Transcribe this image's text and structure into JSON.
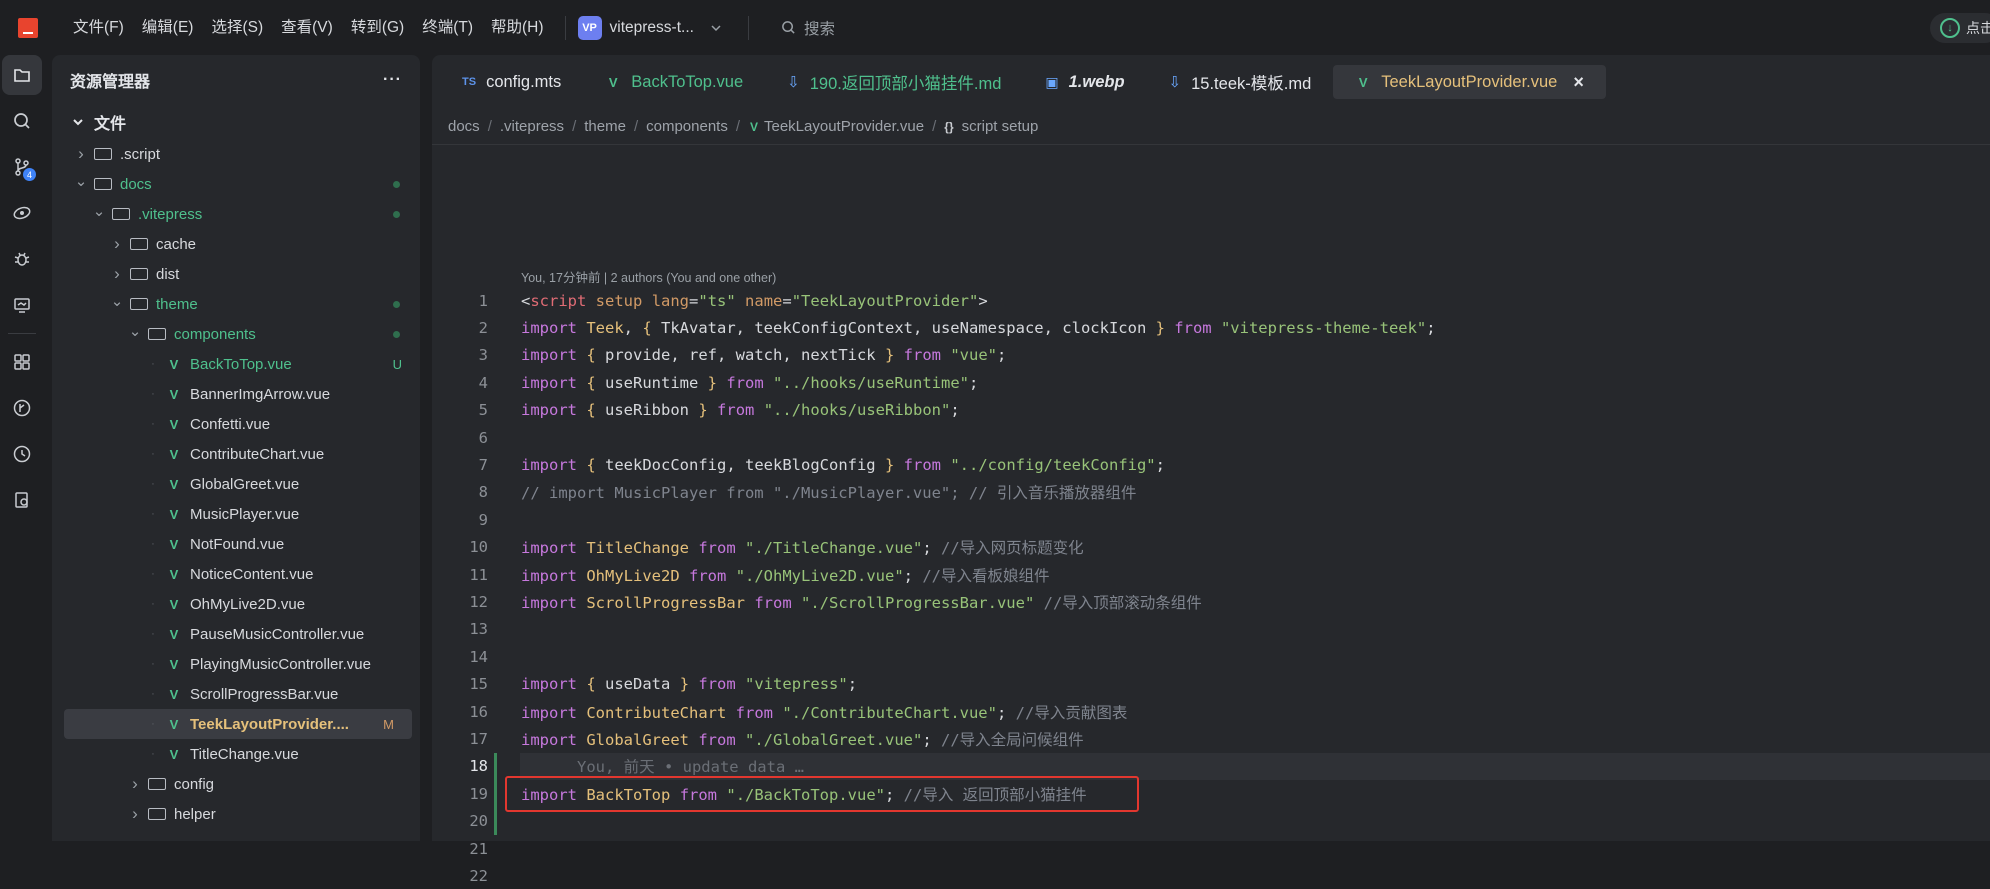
{
  "menu": [
    "文件(F)",
    "编辑(E)",
    "选择(S)",
    "查看(V)",
    "转到(G)",
    "终端(T)",
    "帮助(H)"
  ],
  "project": {
    "badge": "VP",
    "name": "vitepress-t..."
  },
  "search_label": "搜索",
  "right_control_label": "点击",
  "activity_badge": "4",
  "sidebar": {
    "title": "资源管理器",
    "more": "···",
    "section": "文件"
  },
  "tree": [
    {
      "label": ".script",
      "type": "folder",
      "depth": 0,
      "open": false,
      "color": "normal"
    },
    {
      "label": "docs",
      "type": "folder",
      "depth": 0,
      "open": true,
      "color": "green",
      "dot": true
    },
    {
      "label": ".vitepress",
      "type": "folder",
      "depth": 1,
      "open": true,
      "color": "green",
      "dot": true
    },
    {
      "label": "cache",
      "type": "folder",
      "depth": 2,
      "open": false,
      "color": "normal"
    },
    {
      "label": "dist",
      "type": "folder",
      "depth": 2,
      "open": false,
      "color": "normal"
    },
    {
      "label": "theme",
      "type": "folder",
      "depth": 2,
      "open": true,
      "color": "green",
      "dot": true
    },
    {
      "label": "components",
      "type": "folder",
      "depth": 3,
      "open": true,
      "color": "green",
      "dot": true
    },
    {
      "label": "BackToTop.vue",
      "type": "vue",
      "depth": 4,
      "color": "green",
      "status": "U"
    },
    {
      "label": "BannerImgArrow.vue",
      "type": "vue",
      "depth": 4,
      "color": "normal"
    },
    {
      "label": "Confetti.vue",
      "type": "vue",
      "depth": 4,
      "color": "normal"
    },
    {
      "label": "ContributeChart.vue",
      "type": "vue",
      "depth": 4,
      "color": "normal"
    },
    {
      "label": "GlobalGreet.vue",
      "type": "vue",
      "depth": 4,
      "color": "normal"
    },
    {
      "label": "MusicPlayer.vue",
      "type": "vue",
      "depth": 4,
      "color": "normal"
    },
    {
      "label": "NotFound.vue",
      "type": "vue",
      "depth": 4,
      "color": "normal"
    },
    {
      "label": "NoticeContent.vue",
      "type": "vue",
      "depth": 4,
      "color": "normal"
    },
    {
      "label": "OhMyLive2D.vue",
      "type": "vue",
      "depth": 4,
      "color": "normal"
    },
    {
      "label": "PauseMusicController.vue",
      "type": "vue",
      "depth": 4,
      "color": "normal"
    },
    {
      "label": "PlayingMusicController.vue",
      "type": "vue",
      "depth": 4,
      "color": "normal"
    },
    {
      "label": "ScrollProgressBar.vue",
      "type": "vue",
      "depth": 4,
      "color": "normal"
    },
    {
      "label": "TeekLayoutProvider....",
      "type": "vue",
      "depth": 4,
      "color": "mod",
      "status": "M",
      "selected": true
    },
    {
      "label": "TitleChange.vue",
      "type": "vue",
      "depth": 4,
      "color": "normal"
    },
    {
      "label": "config",
      "type": "folder",
      "depth": 3,
      "open": false,
      "color": "normal"
    },
    {
      "label": "helper",
      "type": "folder",
      "depth": 3,
      "open": false,
      "color": "normal"
    }
  ],
  "tabs": [
    {
      "label": "config.mts",
      "icon": "TS",
      "color": "#e4e6ea",
      "italic": false
    },
    {
      "label": "BackToTop.vue",
      "icon": "vue",
      "color": "#4fc08d",
      "italic": false
    },
    {
      "label": "190.返回顶部小猫挂件.md",
      "icon": "md",
      "color": "#4fc08d",
      "italic": false
    },
    {
      "label": "1.webp",
      "icon": "img",
      "color": "#e4e6ea",
      "italic": true
    },
    {
      "label": "15.teek-模板.md",
      "icon": "md",
      "color": "#e4e6ea",
      "italic": false
    },
    {
      "label": "TeekLayoutProvider.vue",
      "icon": "vue",
      "color": "#e5c07b",
      "italic": false,
      "active": true,
      "close": "×"
    }
  ],
  "breadcrumb": [
    "docs",
    ".vitepress",
    "theme",
    "components",
    "TeekLayoutProvider.vue",
    "script setup"
  ],
  "breadcrumb_braces": "{}",
  "codelens": "You, 17分钟前 | 2 authors (You and one other)",
  "current_line": 18,
  "ghost_blame": "You, 前天 • update data …",
  "code": [
    [
      [
        "p",
        "<"
      ],
      [
        "tg",
        "script"
      ],
      [
        "at",
        " setup"
      ],
      [
        "p",
        " "
      ],
      [
        "at",
        "lang"
      ],
      [
        "p",
        "="
      ],
      [
        "st",
        "\"ts\""
      ],
      [
        "p",
        " "
      ],
      [
        "at",
        "name"
      ],
      [
        "p",
        "="
      ],
      [
        "st",
        "\"TeekLayoutProvider\""
      ],
      [
        "p",
        ">"
      ]
    ],
    [
      [
        "k",
        "import"
      ],
      [
        "p",
        " "
      ],
      [
        "f",
        "Teek"
      ],
      [
        "p",
        ", "
      ],
      [
        "f",
        "{"
      ],
      [
        "p",
        " TkAvatar, teekConfigContext, useNamespace, clockIcon "
      ],
      [
        "f",
        "}"
      ],
      [
        "p",
        " "
      ],
      [
        "k",
        "from"
      ],
      [
        "p",
        " "
      ],
      [
        "st",
        "\"vitepress-theme-teek\""
      ],
      [
        "p",
        ";"
      ]
    ],
    [
      [
        "k",
        "import"
      ],
      [
        "p",
        " "
      ],
      [
        "f",
        "{"
      ],
      [
        "p",
        " provide, ref, watch, nextTick "
      ],
      [
        "f",
        "}"
      ],
      [
        "p",
        " "
      ],
      [
        "k",
        "from"
      ],
      [
        "p",
        " "
      ],
      [
        "st",
        "\"vue\""
      ],
      [
        "p",
        ";"
      ]
    ],
    [
      [
        "k",
        "import"
      ],
      [
        "p",
        " "
      ],
      [
        "f",
        "{"
      ],
      [
        "p",
        " useRuntime "
      ],
      [
        "f",
        "}"
      ],
      [
        "p",
        " "
      ],
      [
        "k",
        "from"
      ],
      [
        "p",
        " "
      ],
      [
        "st",
        "\"../hooks/useRuntime\""
      ],
      [
        "p",
        ";"
      ]
    ],
    [
      [
        "k",
        "import"
      ],
      [
        "p",
        " "
      ],
      [
        "f",
        "{"
      ],
      [
        "p",
        " useRibbon "
      ],
      [
        "f",
        "}"
      ],
      [
        "p",
        " "
      ],
      [
        "k",
        "from"
      ],
      [
        "p",
        " "
      ],
      [
        "st",
        "\"../hooks/useRibbon\""
      ],
      [
        "p",
        ";"
      ]
    ],
    [],
    [
      [
        "k",
        "import"
      ],
      [
        "p",
        " "
      ],
      [
        "f",
        "{"
      ],
      [
        "p",
        " teekDocConfig, teekBlogConfig "
      ],
      [
        "f",
        "}"
      ],
      [
        "p",
        " "
      ],
      [
        "k",
        "from"
      ],
      [
        "p",
        " "
      ],
      [
        "st",
        "\"../config/teekConfig\""
      ],
      [
        "p",
        ";"
      ]
    ],
    [
      [
        "cm",
        "// import MusicPlayer from \"./MusicPlayer.vue\"; // 引入音乐播放器组件"
      ]
    ],
    [],
    [
      [
        "k",
        "import"
      ],
      [
        "p",
        " "
      ],
      [
        "f",
        "TitleChange"
      ],
      [
        "p",
        " "
      ],
      [
        "k",
        "from"
      ],
      [
        "p",
        " "
      ],
      [
        "st",
        "\"./TitleChange.vue\""
      ],
      [
        "p",
        "; "
      ],
      [
        "cm",
        "//导入网页标题变化"
      ]
    ],
    [
      [
        "k",
        "import"
      ],
      [
        "p",
        " "
      ],
      [
        "f",
        "OhMyLive2D"
      ],
      [
        "p",
        " "
      ],
      [
        "k",
        "from"
      ],
      [
        "p",
        " "
      ],
      [
        "st",
        "\"./OhMyLive2D.vue\""
      ],
      [
        "p",
        "; "
      ],
      [
        "cm",
        "//导入看板娘组件"
      ]
    ],
    [
      [
        "k",
        "import"
      ],
      [
        "p",
        " "
      ],
      [
        "f",
        "ScrollProgressBar"
      ],
      [
        "p",
        " "
      ],
      [
        "k",
        "from"
      ],
      [
        "p",
        " "
      ],
      [
        "st",
        "\"./ScrollProgressBar.vue\""
      ],
      [
        "p",
        " "
      ],
      [
        "cm",
        "//导入顶部滚动条组件"
      ]
    ],
    [],
    [],
    [
      [
        "k",
        "import"
      ],
      [
        "p",
        " "
      ],
      [
        "f",
        "{"
      ],
      [
        "p",
        " useData "
      ],
      [
        "f",
        "}"
      ],
      [
        "p",
        " "
      ],
      [
        "k",
        "from"
      ],
      [
        "p",
        " "
      ],
      [
        "st",
        "\"vitepress\""
      ],
      [
        "p",
        ";"
      ]
    ],
    [
      [
        "k",
        "import"
      ],
      [
        "p",
        " "
      ],
      [
        "f",
        "ContributeChart"
      ],
      [
        "p",
        " "
      ],
      [
        "k",
        "from"
      ],
      [
        "p",
        " "
      ],
      [
        "st",
        "\"./ContributeChart.vue\""
      ],
      [
        "p",
        "; "
      ],
      [
        "cm",
        "//导入贡献图表"
      ]
    ],
    [
      [
        "k",
        "import"
      ],
      [
        "p",
        " "
      ],
      [
        "f",
        "GlobalGreet"
      ],
      [
        "p",
        " "
      ],
      [
        "k",
        "from"
      ],
      [
        "p",
        " "
      ],
      [
        "st",
        "\"./GlobalGreet.vue\""
      ],
      [
        "p",
        "; "
      ],
      [
        "cm",
        "//导入全局问候组件"
      ]
    ],
    [],
    [
      [
        "k",
        "import"
      ],
      [
        "p",
        " "
      ],
      [
        "f",
        "BackToTop"
      ],
      [
        "p",
        " "
      ],
      [
        "k",
        "from"
      ],
      [
        "p",
        " "
      ],
      [
        "st",
        "\"./BackToTop.vue\""
      ],
      [
        "p",
        "; "
      ],
      [
        "cm",
        "//导入 返回顶部小猫挂件"
      ]
    ],
    [],
    [],
    []
  ]
}
